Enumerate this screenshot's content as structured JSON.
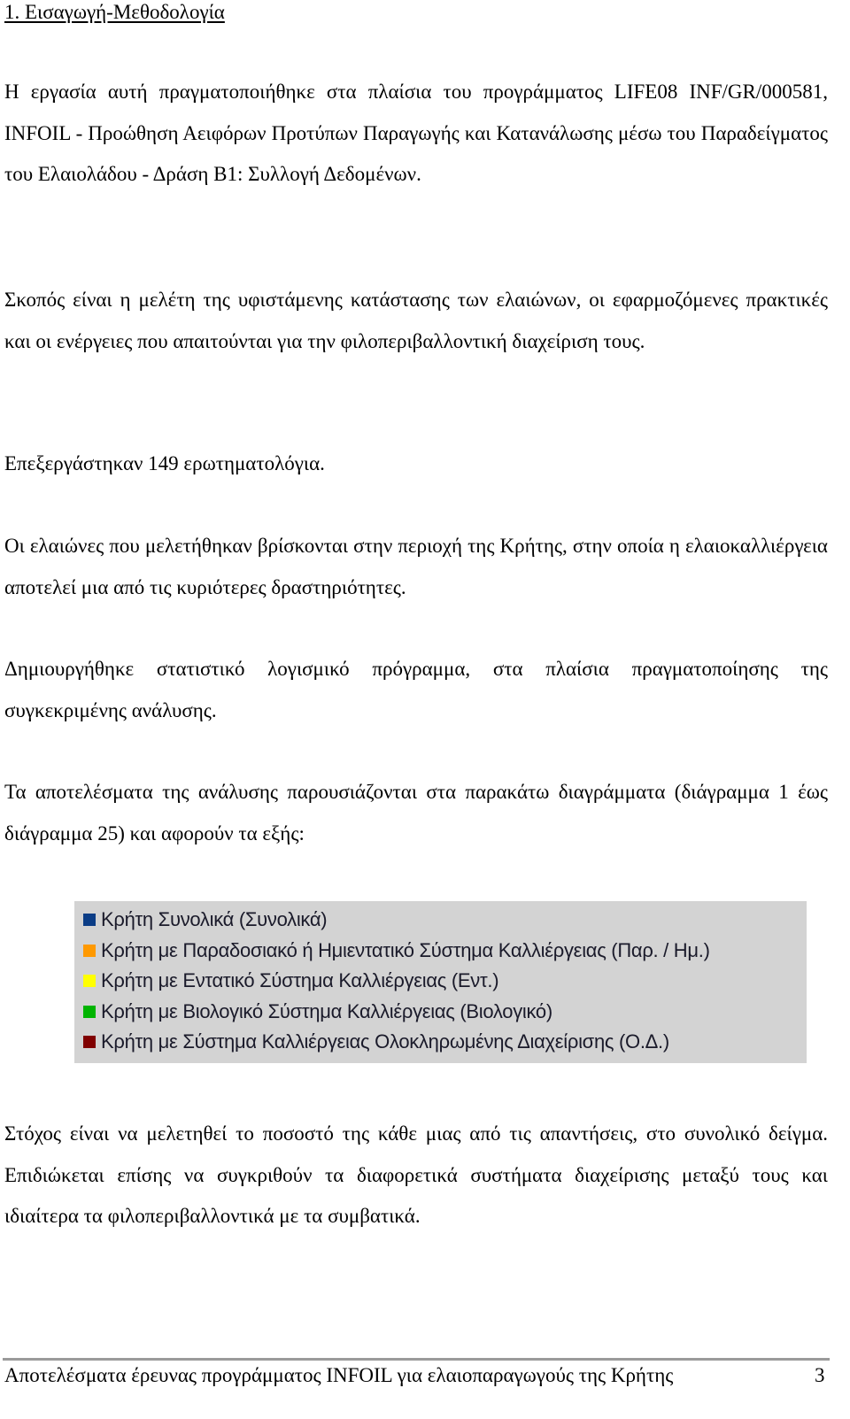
{
  "section": {
    "heading": "1. Εισαγωγή-Μεθοδολογία"
  },
  "paragraphs": [
    "Η εργασία αυτή πραγματοποιήθηκε στα πλαίσια του προγράμματος LIFE08 INF/GR/000581, INFOIL - Προώθηση Αειφόρων Προτύπων Παραγωγής και Κατανάλωσης μέσω του Παραδείγματος του Ελαιολάδου - Δράση Β1: Συλλογή Δεδομένων.",
    "Σκοπός είναι η μελέτη της υφιστάμενης κατάστασης των ελαιώνων, οι εφαρμοζόμενες πρακτικές και οι ενέργειες που απαιτούνται για την φιλοπεριβαλλοντική διαχείριση τους.",
    "Επεξεργάστηκαν 149 ερωτηματολόγια.",
    "Οι ελαιώνες που μελετήθηκαν βρίσκονται στην περιοχή της Κρήτης, στην οποία η ελαιοκαλλιέργεια αποτελεί μια από τις κυριότερες δραστηριότητες.",
    "Δημιουργήθηκε στατιστικό λογισμικό πρόγραμμα, στα πλαίσια πραγματοποίησης της συγκεκριμένης ανάλυσης.",
    "Τα αποτελέσματα της ανάλυσης παρουσιάζονται στα παρακάτω διαγράμματα (διάγραμμα 1 έως διάγραμμα 25) και αφορούν τα εξής:",
    "Στόχος είναι να μελετηθεί το ποσοστό της κάθε μιας από τις απαντήσεις, στο συνολικό δείγμα. Επιδιώκεται επίσης να συγκριθούν τα διαφορετικά συστήματα διαχείρισης μεταξύ τους και ιδιαίτερα τα φιλοπεριβαλλοντικά με τα συμβατικά."
  ],
  "legend": {
    "items": [
      {
        "label": "Κρήτη Συνολικά (Συνολικά)",
        "color": "#0b3d86"
      },
      {
        "label": "Κρήτη με Παραδοσιακό ή Ημιεντατικό Σύστημα Καλλιέργειας (Παρ. / Ημ.)",
        "color": "#ff9900"
      },
      {
        "label": "Κρήτη με Εντατικό Σύστημα Καλλιέργειας (Εντ.)",
        "color": "#ffff00"
      },
      {
        "label": "Κρήτη με Βιολογικό Σύστημα Καλλιέργειας (Βιολογικό)",
        "color": "#00b400"
      },
      {
        "label": "Κρήτη με Σύστημα Καλλιέργειας Ολοκληρωμένης Διαχείρισης (Ο.Δ.)",
        "color": "#800000"
      }
    ]
  },
  "footer": {
    "title": "Αποτελέσματα έρευνας προγράμματος INFOIL για ελαιοπαραγωγούς της Κρήτης",
    "page_number": "3"
  }
}
